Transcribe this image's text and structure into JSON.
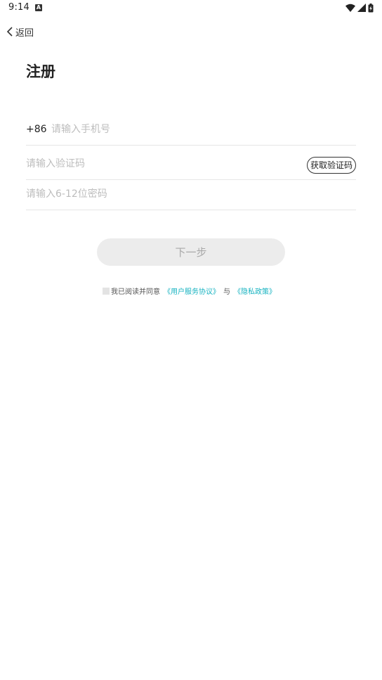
{
  "status_bar": {
    "time": "9:14",
    "notification_icon": "a-letter-icon",
    "wifi_icon": "wifi-icon",
    "signal_icon": "signal-icon",
    "battery_icon": "battery-charging-icon"
  },
  "nav": {
    "back_label": "返回",
    "back_icon": "chevron-left-icon"
  },
  "page": {
    "title": "注册"
  },
  "form": {
    "country_code": "+86",
    "phone_placeholder": "请输入手机号",
    "phone_value": "",
    "code_placeholder": "请输入验证码",
    "code_value": "",
    "get_code_label": "获取验证码",
    "password_placeholder": "请输入6-12位密码",
    "password_value": ""
  },
  "actions": {
    "next_label": "下一步"
  },
  "agreement": {
    "prefix": "我已阅读并同意",
    "user_agreement": "《用户服务协议》",
    "conjunction": "与",
    "privacy_policy": "《隐私政策》",
    "checked": false
  },
  "colors": {
    "link": "#17b3c1",
    "button_disabled_bg": "#ececec",
    "button_disabled_text": "#a9a9a9",
    "divider": "#e6e6e6"
  }
}
